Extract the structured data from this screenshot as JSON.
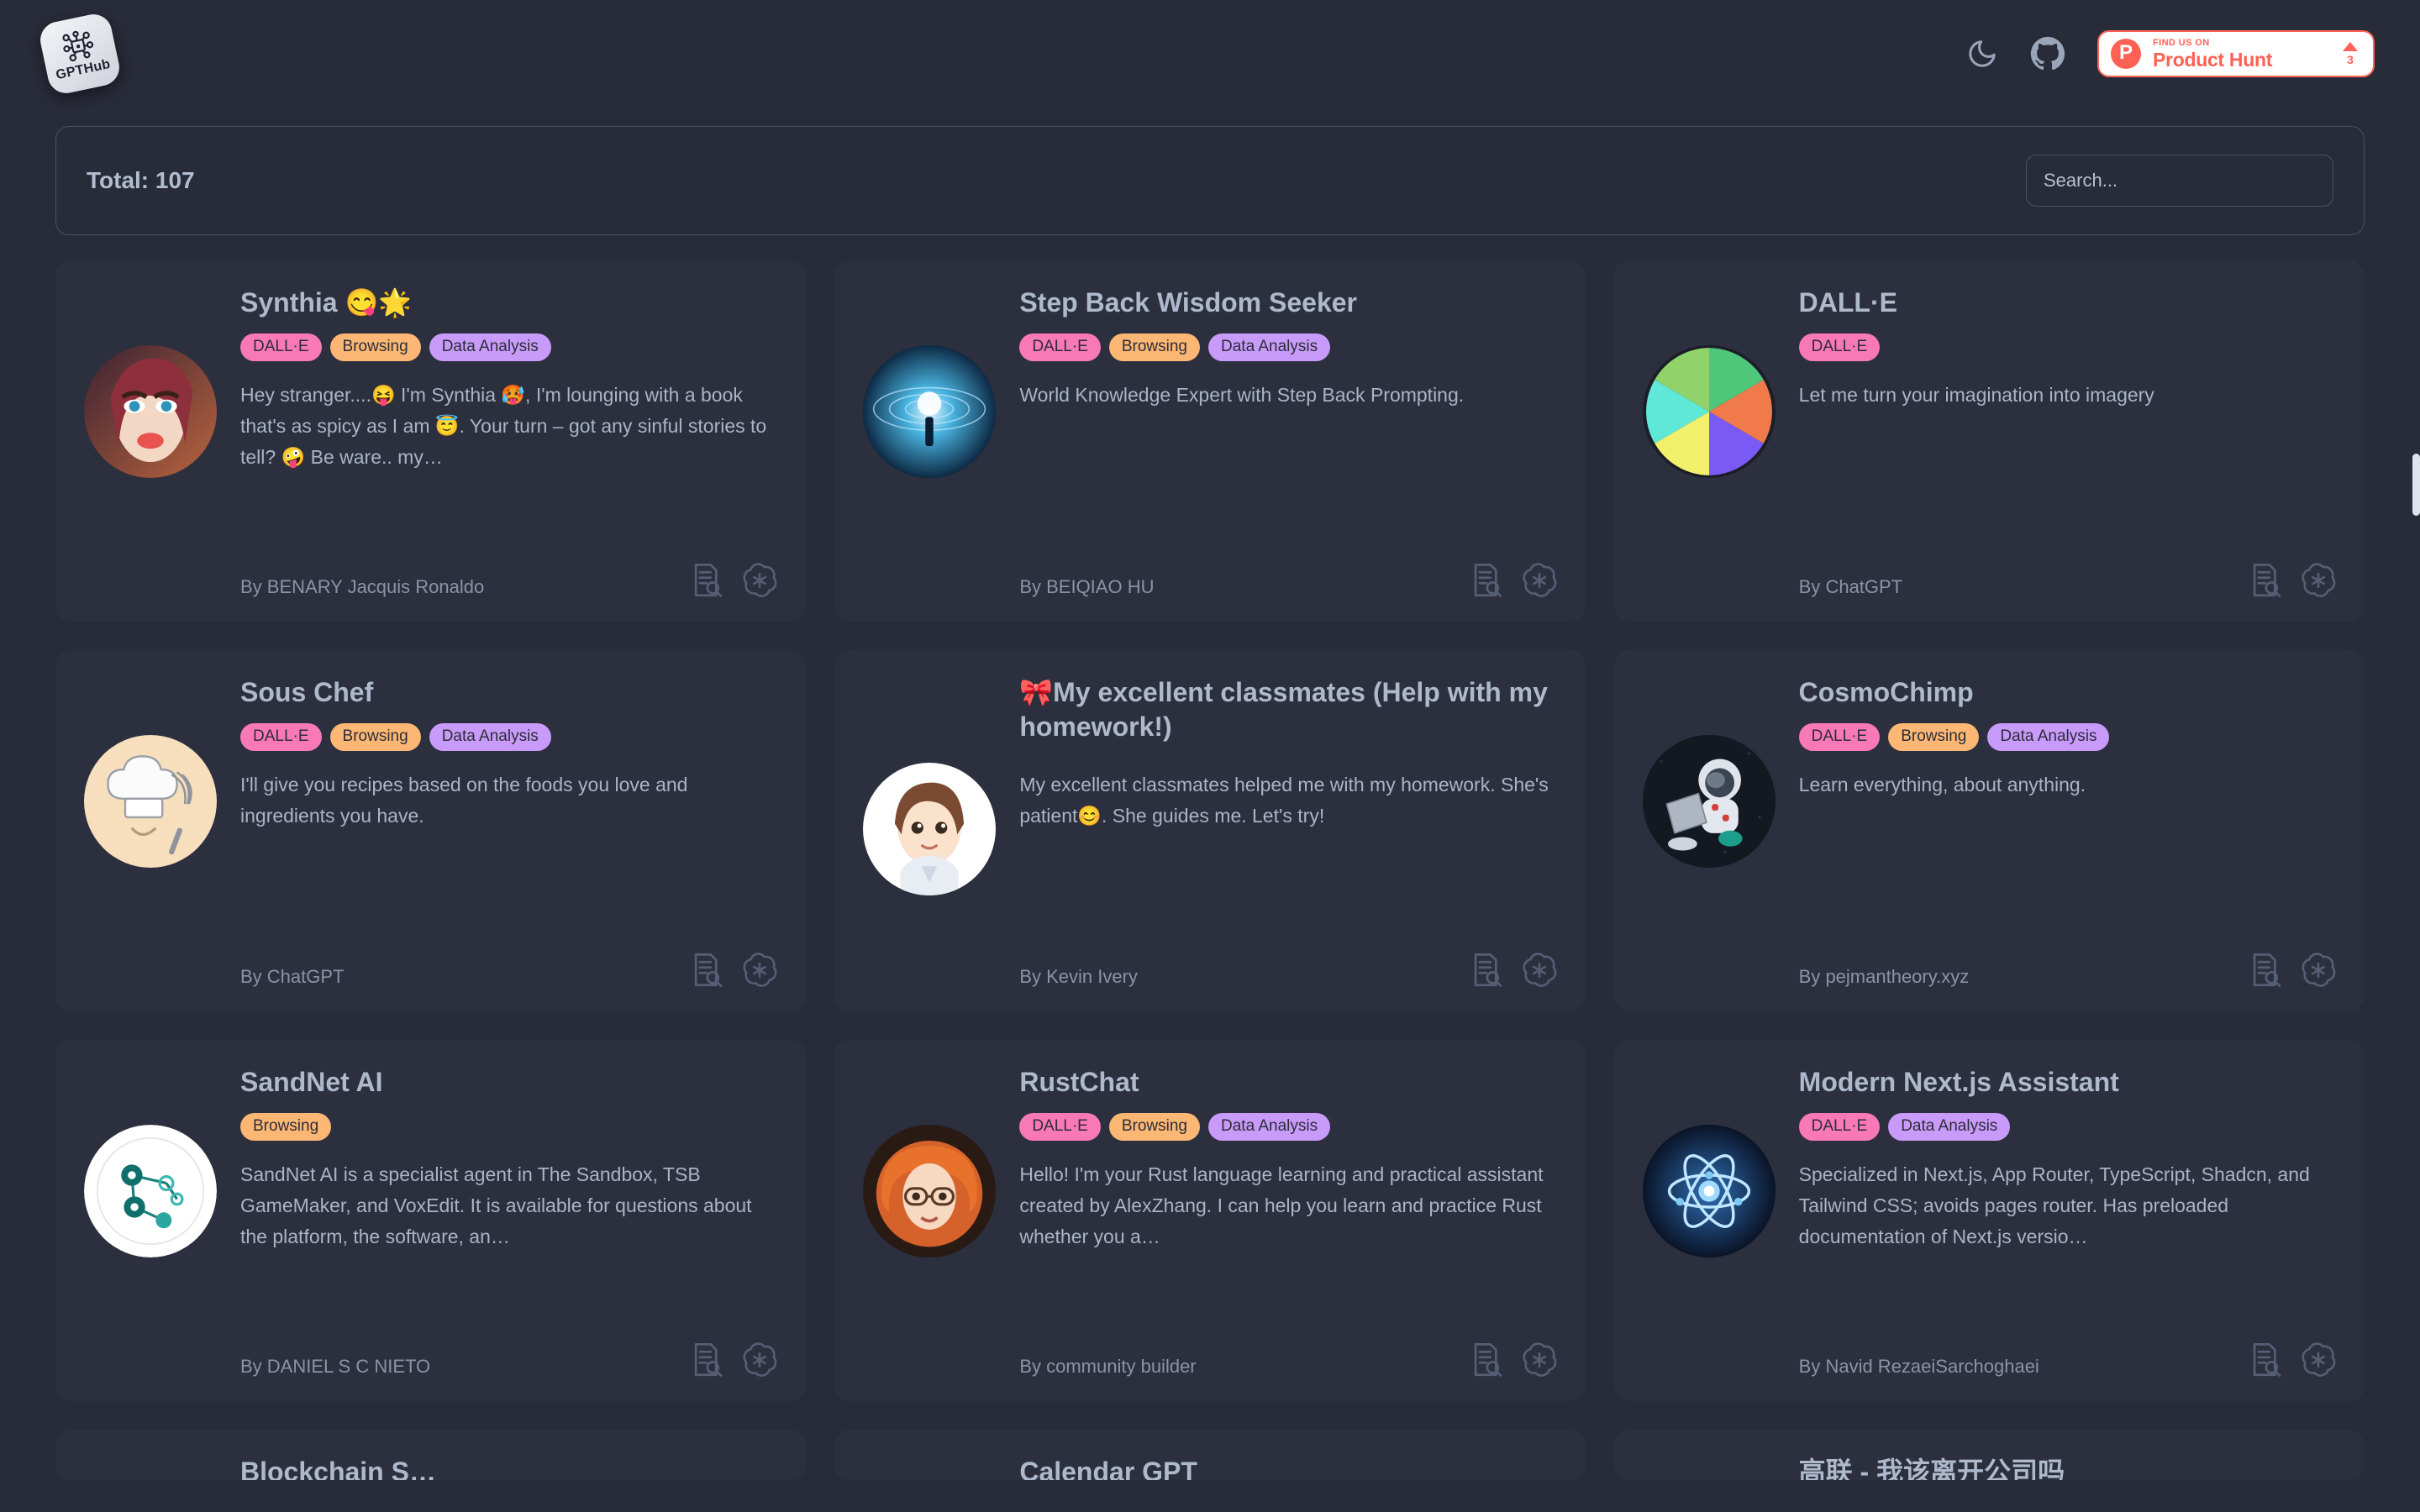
{
  "header": {
    "logo": {
      "name": "GPTHub",
      "icon": "gpthub-chip-logo"
    },
    "theme_toggle_icon": "moon-icon",
    "github_icon": "github-icon",
    "product_hunt": {
      "kicker": "FIND US ON",
      "title": "Product Hunt",
      "upvotes": "3",
      "accent": "#ff6154"
    }
  },
  "toolbar": {
    "total_label": "Total: 107",
    "search_placeholder": "Search...",
    "search_value": ""
  },
  "tag_colors": {
    "DALL·E": "#f979b8",
    "Browsing": "#fcb775",
    "Data Analysis": "#c89bfa"
  },
  "action_icons": {
    "details": "document-search-icon",
    "open": "openai-logo-icon"
  },
  "cards": [
    {
      "title": "Synthia 😋🌟",
      "tags": [
        "DALL·E",
        "Browsing",
        "Data Analysis"
      ],
      "description": "Hey stranger....😝 I'm Synthia 🥵, I'm lounging with a book that's as spicy as I am 😇. Your turn – got any sinful stories to tell? 🤪 Be ware.. my…",
      "author": "By BENARY Jacquis Ronaldo",
      "avatar": "synthia-portrait-avatar"
    },
    {
      "title": "Step Back Wisdom Seeker",
      "tags": [
        "DALL·E",
        "Browsing",
        "Data Analysis"
      ],
      "description": "World Knowledge Expert with Step Back Prompting.",
      "author": "By BEIQIAO HU",
      "avatar": "cosmic-tunnel-avatar"
    },
    {
      "title": "DALL·E",
      "tags": [
        "DALL·E"
      ],
      "description": "Let me turn your imagination into imagery",
      "author": "By ChatGPT",
      "avatar": "color-wheel-avatar"
    },
    {
      "title": "Sous Chef",
      "tags": [
        "DALL·E",
        "Browsing",
        "Data Analysis"
      ],
      "description": "I'll give you recipes based on the foods you love and ingredients you have.",
      "author": "By ChatGPT",
      "avatar": "chef-hat-whisk-avatar"
    },
    {
      "title": "🎀My excellent classmates (Help with my homework!)",
      "tags": [],
      "description": "My excellent classmates helped me with my homework. She's patient😊. She guides me. Let's try!",
      "author": "By Kevin Ivery",
      "avatar": "anime-girl-avatar"
    },
    {
      "title": "CosmoChimp",
      "tags": [
        "DALL·E",
        "Browsing",
        "Data Analysis"
      ],
      "description": "Learn everything, about anything.",
      "author": "By pejmantheory.xyz",
      "avatar": "astronaut-chimp-avatar"
    },
    {
      "title": "SandNet AI",
      "tags": [
        "Browsing"
      ],
      "description": "SandNet AI is a specialist agent in The Sandbox, TSB GameMaker, and VoxEdit. It is available for questions about the platform, the software, an…",
      "author": "By DANIEL S C NIETO",
      "avatar": "network-nodes-avatar"
    },
    {
      "title": "RustChat",
      "tags": [
        "DALL·E",
        "Browsing",
        "Data Analysis"
      ],
      "description": "Hello! I'm your Rust language learning and practical assistant created by AlexZhang. I can help you learn and practice Rust whether you a…",
      "author": "By community builder",
      "avatar": "red-hair-woman-avatar"
    },
    {
      "title": "Modern Next.js Assistant",
      "tags": [
        "DALL·E",
        "Data Analysis"
      ],
      "description": "Specialized in Next.js, App Router, TypeScript, Shadcn, and Tailwind CSS; avoids pages router. Has preloaded documentation of Next.js versio…",
      "author": "By Navid RezaeiSarchoghaei",
      "avatar": "atom-glow-avatar"
    }
  ],
  "peek_cards": [
    {
      "title": "Blockchain S…"
    },
    {
      "title": "Calendar GPT"
    },
    {
      "title": "高联 - 我该离开公司吗"
    }
  ]
}
